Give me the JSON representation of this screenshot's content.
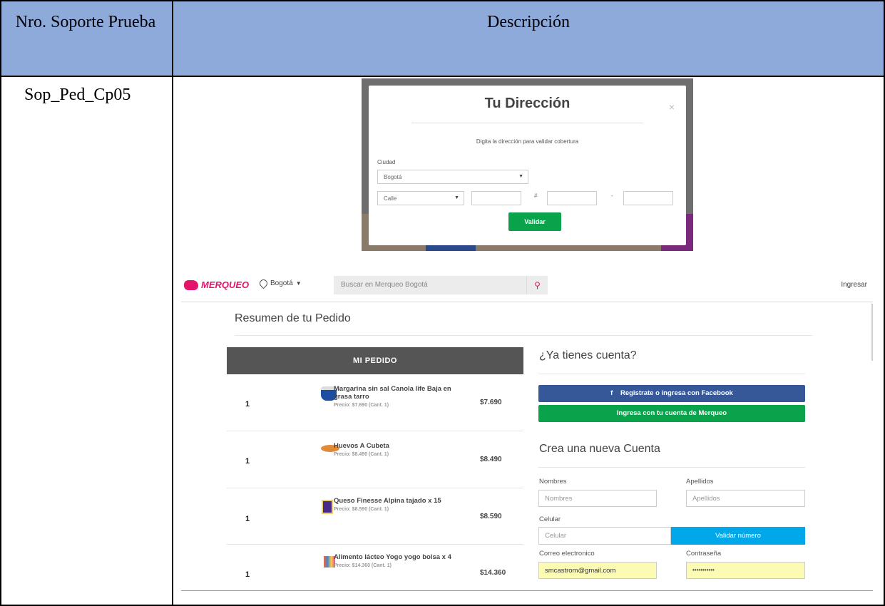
{
  "table": {
    "header_col1": "Nro. Soporte Prueba",
    "header_col2": "Descripción",
    "row_id": "Sop_Ped_Cp05"
  },
  "modal": {
    "title": "Tu Dirección",
    "close": "×",
    "subtitle": "Digita la dirección para validar cobertura",
    "city_label": "Ciudad",
    "city_value": "Bogotá",
    "street_type_value": "Calle",
    "hash_sep": "#",
    "dash_sep": "-",
    "validate_button": "Validar"
  },
  "navbar": {
    "logo": "MERQUEO",
    "city": "Bogotá",
    "search_placeholder": "Buscar en Merqueo Bogotá",
    "login": "Ingresar"
  },
  "order": {
    "title": "Resumen de tu Pedido",
    "header": "MI PEDIDO",
    "items": [
      {
        "qty": "1",
        "name": "Margarina sin sal Canola life Baja en grasa tarro",
        "detail": "Precio: $7.690 (Cant. 1)",
        "price": "$7.690"
      },
      {
        "qty": "1",
        "name": "Huevos A Cubeta",
        "detail": "Precio: $8.490 (Cant. 1)",
        "price": "$8.490"
      },
      {
        "qty": "1",
        "name": "Queso Finesse Alpina tajado x 15",
        "detail": "Precio: $8.590 (Cant. 1)",
        "price": "$8.590"
      },
      {
        "qty": "1",
        "name": "Alimento lácteo Yogo yogo bolsa x 4",
        "detail": "Precio: $14.360 (Cant. 1)",
        "price": "$14.360"
      }
    ]
  },
  "account": {
    "have_account_title": "¿Ya tienes cuenta?",
    "facebook_button": "Registrate o ingresa con Facebook",
    "merqueo_button": "Ingresa con tu cuenta de Merqueo",
    "new_account_title": "Crea una nueva Cuenta",
    "first_name_label": "Nombres",
    "first_name_placeholder": "Nombres",
    "last_name_label": "Apellidos",
    "last_name_placeholder": "Apellidos",
    "phone_label": "Celular",
    "phone_placeholder": "Celular",
    "validate_number_button": "Validar número",
    "email_label": "Correo electronico",
    "email_value": "smcastrom@gmail.com",
    "password_label": "Contraseña",
    "password_value": "•••••••••••"
  },
  "colors": {
    "header_bg": "#8eaadb",
    "brand": "#e5146b",
    "facebook": "#365899",
    "green": "#0aa24b",
    "blue_button": "#00a8ea",
    "autofill": "#fbfbb4"
  }
}
